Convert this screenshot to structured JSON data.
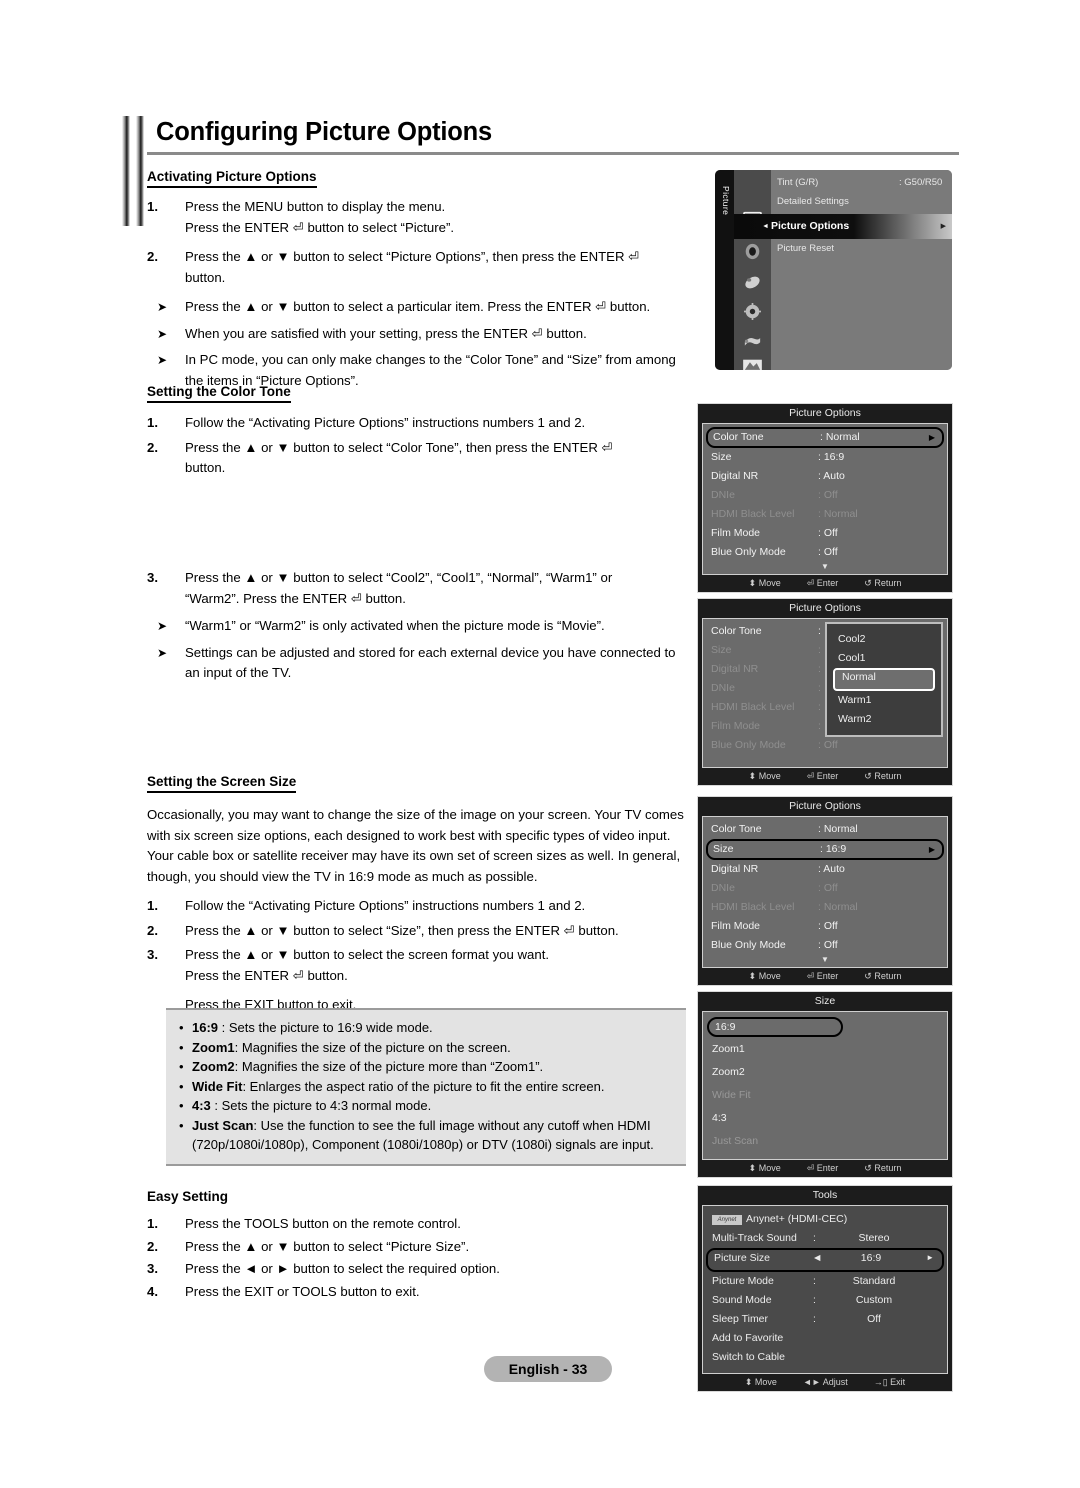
{
  "page": {
    "title": "Configuring Picture Options",
    "footer_badge": "English - 33"
  },
  "sections": {
    "activating": {
      "heading": "Activating Picture Options",
      "steps": [
        {
          "num": "1.",
          "line1": "Press the MENU button to display the menu.",
          "line2": "Press the ENTER ⏎ button to select “Picture”."
        },
        {
          "num": "2.",
          "line1": "Press the ▲ or ▼ button to select “Picture Options”, then press the ENTER ⏎",
          "line2": "button."
        }
      ],
      "bullets": [
        "Press the ▲ or ▼ button to select a particular item. Press the ENTER ⏎ button.",
        "When you are satisfied with your setting, press the ENTER ⏎ button.",
        "In PC mode, you can only make changes to the “Color Tone” and “Size” from among the items in “Picture Options”."
      ]
    },
    "color_tone": {
      "heading": "Setting the Color Tone",
      "steps": [
        {
          "num": "1.",
          "line1": "Follow the “Activating Picture Options” instructions numbers 1 and 2.",
          "line2": ""
        },
        {
          "num": "2.",
          "line1": "Press the ▲ or ▼ button to select “Color Tone”, then press the ENTER ⏎",
          "line2": "button."
        },
        {
          "num": "3.",
          "line1": "Press the ▲ or ▼ button to select “Cool2”, “Cool1”, “Normal”, “Warm1” or",
          "line2": "“Warm2”. Press the ENTER ⏎ button."
        }
      ],
      "bullets": [
        "“Warm1” or “Warm2” is only activated when the picture mode is “Movie”.",
        "Settings can be adjusted and stored for each external device you have connected to an input of the TV."
      ]
    },
    "screen_size": {
      "heading": "Setting the Screen Size",
      "paragraph": "Occasionally, you may want to change the size of the image on your screen. Your TV comes with six screen size options, each designed to work best with specific types of video input. Your cable box or satellite receiver may have its own set of screen sizes as well. In general, though, you should view the TV in 16:9 mode as much as possible.",
      "steps": [
        {
          "num": "1.",
          "line1": "Follow the “Activating Picture Options” instructions numbers 1 and 2.",
          "line2": ""
        },
        {
          "num": "2.",
          "line1": "Press the ▲ or ▼ button to select “Size”, then press the ENTER ⏎ button.",
          "line2": ""
        },
        {
          "num": "3.",
          "line1": "Press the ▲ or ▼ button to select the screen format you want.",
          "line2": "Press the ENTER ⏎ button."
        }
      ],
      "exit_note": "Press the EXIT button to exit.",
      "options": [
        {
          "name": "16:9",
          "sep": " : ",
          "desc": "Sets the picture to 16:9 wide mode."
        },
        {
          "name": "Zoom1",
          "sep": ": ",
          "desc": "Magnifies the size of the picture on the screen."
        },
        {
          "name": "Zoom2",
          "sep": ": ",
          "desc": "Magnifies the size of the picture more than “Zoom1”."
        },
        {
          "name": "Wide Fit",
          "sep": ": ",
          "desc": "Enlarges the aspect ratio of the picture to fit the entire screen."
        },
        {
          "name": "4:3",
          "sep": " : ",
          "desc": "Sets the picture to 4:3 normal mode."
        },
        {
          "name": "Just Scan",
          "sep": ": ",
          "desc": "Use the function to see the full image without any cutoff when HDMI (720p/1080i/1080p), Component (1080i/1080p) or DTV (1080i) signals are input."
        }
      ]
    },
    "easy_setting": {
      "heading": "Easy Setting",
      "steps": [
        {
          "num": "1.",
          "line1": "Press the TOOLS button on the remote control.",
          "line2": ""
        },
        {
          "num": "2.",
          "line1": "Press the ▲ or ▼ button to select “Picture Size”.",
          "line2": ""
        },
        {
          "num": "3.",
          "line1": "Press the ◄ or ► button to select the required option.",
          "line2": ""
        },
        {
          "num": "4.",
          "line1": "Press the EXIT or TOOLS button to exit.",
          "line2": ""
        }
      ]
    }
  },
  "osd": {
    "main_menu": {
      "spine_label": "Picture",
      "rows": [
        {
          "label": "Tint (G/R)",
          "value": ": G50/R50"
        },
        {
          "label": "Detailed Settings",
          "value": ""
        },
        {
          "label": "Picture Reset",
          "value": ""
        }
      ],
      "highlight": "Picture Options",
      "icons": [
        "picture-icon",
        "sound-icon",
        "channel-icon",
        "setup-icon",
        "input-icon",
        "support-icon"
      ]
    },
    "picture_options_1": {
      "title": "Picture Options",
      "items": [
        {
          "label": "Color Tone",
          "value": ": Normal",
          "state": "selected"
        },
        {
          "label": "Size",
          "value": ": 16:9",
          "state": "normal"
        },
        {
          "label": "Digital NR",
          "value": ": Auto",
          "state": "normal"
        },
        {
          "label": "DNIe",
          "value": ": Off",
          "state": "dim"
        },
        {
          "label": "HDMI Black Level",
          "value": ": Normal",
          "state": "dim"
        },
        {
          "label": "Film Mode",
          "value": ": Off",
          "state": "normal"
        },
        {
          "label": "Blue Only Mode",
          "value": ": Off",
          "state": "normal"
        }
      ],
      "more_indicator": "▼",
      "footer": [
        "⬍ Move",
        "⏎ Enter",
        "↺ Return"
      ]
    },
    "picture_options_2": {
      "title": "Picture Options",
      "items": [
        {
          "label": "Color Tone",
          "value": ":",
          "state": "normal"
        },
        {
          "label": "Size",
          "value": ":",
          "state": "dim"
        },
        {
          "label": "Digital NR",
          "value": ":",
          "state": "dim"
        },
        {
          "label": "DNIe",
          "value": ":",
          "state": "dim"
        },
        {
          "label": "HDMI Black Level",
          "value": ":",
          "state": "dim"
        },
        {
          "label": "Film Mode",
          "value": ":",
          "state": "dim"
        },
        {
          "label": "Blue Only Mode",
          "value": ": Off",
          "state": "dim"
        }
      ],
      "dropdown": {
        "options": [
          "Cool2",
          "Cool1",
          "Normal",
          "Warm1",
          "Warm2"
        ],
        "selected": "Normal"
      },
      "footer": [
        "⬍ Move",
        "⏎ Enter",
        "↺ Return"
      ]
    },
    "picture_options_3": {
      "title": "Picture Options",
      "items": [
        {
          "label": "Color Tone",
          "value": ": Normal",
          "state": "normal"
        },
        {
          "label": "Size",
          "value": ": 16:9",
          "state": "selected"
        },
        {
          "label": "Digital NR",
          "value": ": Auto",
          "state": "normal"
        },
        {
          "label": "DNIe",
          "value": ": Off",
          "state": "dim"
        },
        {
          "label": "HDMI Black Level",
          "value": ": Normal",
          "state": "dim"
        },
        {
          "label": "Film Mode",
          "value": ": Off",
          "state": "normal"
        },
        {
          "label": "Blue Only Mode",
          "value": ": Off",
          "state": "normal"
        }
      ],
      "more_indicator": "▼",
      "footer": [
        "⬍ Move",
        "⏎ Enter",
        "↺ Return"
      ]
    },
    "size_menu": {
      "title": "Size",
      "items": [
        {
          "label": "16:9",
          "state": "selected"
        },
        {
          "label": "Zoom1",
          "state": "normal"
        },
        {
          "label": "Zoom2",
          "state": "normal"
        },
        {
          "label": "Wide Fit",
          "state": "dim"
        },
        {
          "label": "4:3",
          "state": "normal"
        },
        {
          "label": "Just Scan",
          "state": "dim"
        }
      ],
      "footer": [
        "⬍ Move",
        "⏎ Enter",
        "↺ Return"
      ]
    },
    "tools_menu": {
      "title": "Tools",
      "badge": "Anynet",
      "items": [
        {
          "label": "Anynet+ (HDMI-CEC)",
          "colon": "",
          "value": "",
          "state": "badge"
        },
        {
          "label": "Multi-Track Sound",
          "colon": ":",
          "value": "Stereo",
          "state": "normal"
        },
        {
          "label": "Picture Size",
          "colon": "◄",
          "value": "16:9",
          "state": "selected"
        },
        {
          "label": "Picture Mode",
          "colon": ":",
          "value": "Standard",
          "state": "normal"
        },
        {
          "label": "Sound Mode",
          "colon": ":",
          "value": "Custom",
          "state": "normal"
        },
        {
          "label": "Sleep Timer",
          "colon": ":",
          "value": "Off",
          "state": "normal"
        },
        {
          "label": "Add to Favorite",
          "colon": "",
          "value": "",
          "state": "normal"
        },
        {
          "label": "Switch to Cable",
          "colon": "",
          "value": "",
          "state": "normal"
        }
      ],
      "footer": [
        "⬍ Move",
        "◄► Adjust",
        "→▯ Exit"
      ]
    }
  }
}
